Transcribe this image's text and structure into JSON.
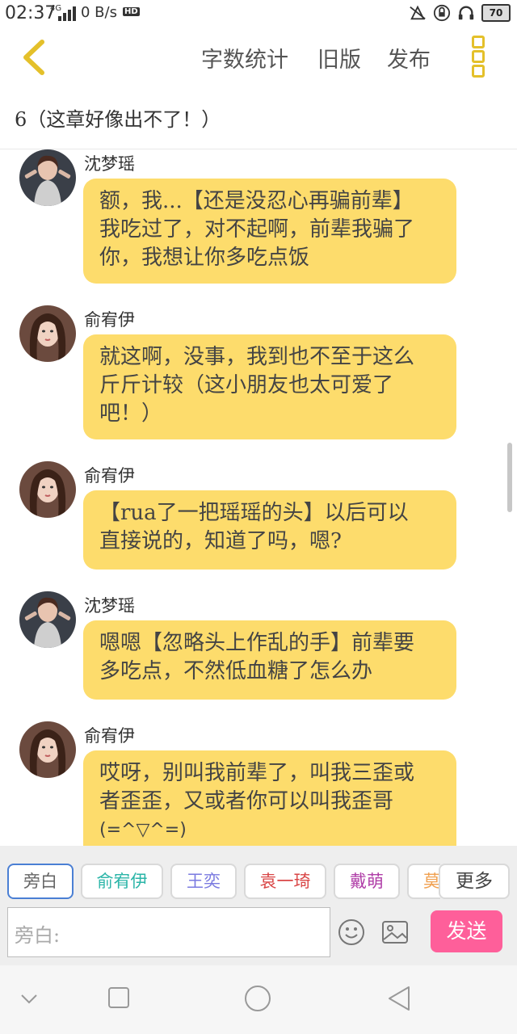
{
  "status_bar": {
    "time": "02:37",
    "network": "4G",
    "speed": "0 B/s",
    "hd": "HD",
    "battery": "70"
  },
  "header": {
    "actions": [
      "字数统计",
      "旧版",
      "发布"
    ]
  },
  "chapter_title": "6（这章好像出不了！）",
  "messages": [
    {
      "name": "沈梦瑶",
      "avatar": "avatar-shen",
      "text": [
        "额，我...【还是没忍心再骗前辈】",
        "我吃过了，对不起啊，前辈我骗了",
        "你，我想让你多吃点饭"
      ]
    },
    {
      "name": "俞宥伊",
      "avatar": "avatar-yu",
      "text": [
        "就这啊，没事，我到也不至于这么",
        "斤斤计较（这小朋友也太可爱了",
        "吧！）"
      ]
    },
    {
      "name": "俞宥伊",
      "avatar": "avatar-yu",
      "text": [
        "【rua了一把瑶瑶的头】以后可以",
        "直接说的，知道了吗，嗯?"
      ]
    },
    {
      "name": "沈梦瑶",
      "avatar": "avatar-shen",
      "text": [
        "嗯嗯【忽略头上作乱的手】前辈要",
        "多吃点，不然低血糖了怎么办"
      ]
    },
    {
      "name": "俞宥伊",
      "avatar": "avatar-yu",
      "text": [
        "哎呀，别叫我前辈了，叫我三歪或",
        "者歪歪，又或者你可以叫我歪哥",
        "(=^▽^=)"
      ]
    }
  ],
  "compose": {
    "roles": [
      {
        "label": "旁白",
        "color": "#666666"
      },
      {
        "label": "俞宥伊",
        "color": "#2bb5a8"
      },
      {
        "label": "王奕",
        "color": "#7a7ae0"
      },
      {
        "label": "袁一琦",
        "color": "#d94646"
      },
      {
        "label": "戴萌",
        "color": "#b03fa8"
      },
      {
        "label": "莫",
        "color": "#f0a050"
      }
    ],
    "more_label": "更多",
    "input_placeholder": "旁白:",
    "send_label": "发送"
  },
  "colors": {
    "bubble": "#fddc6c",
    "accent_yellow": "#e4c02a",
    "send": "#fe5f9a",
    "selected_role_border": "#4a7fd4"
  }
}
